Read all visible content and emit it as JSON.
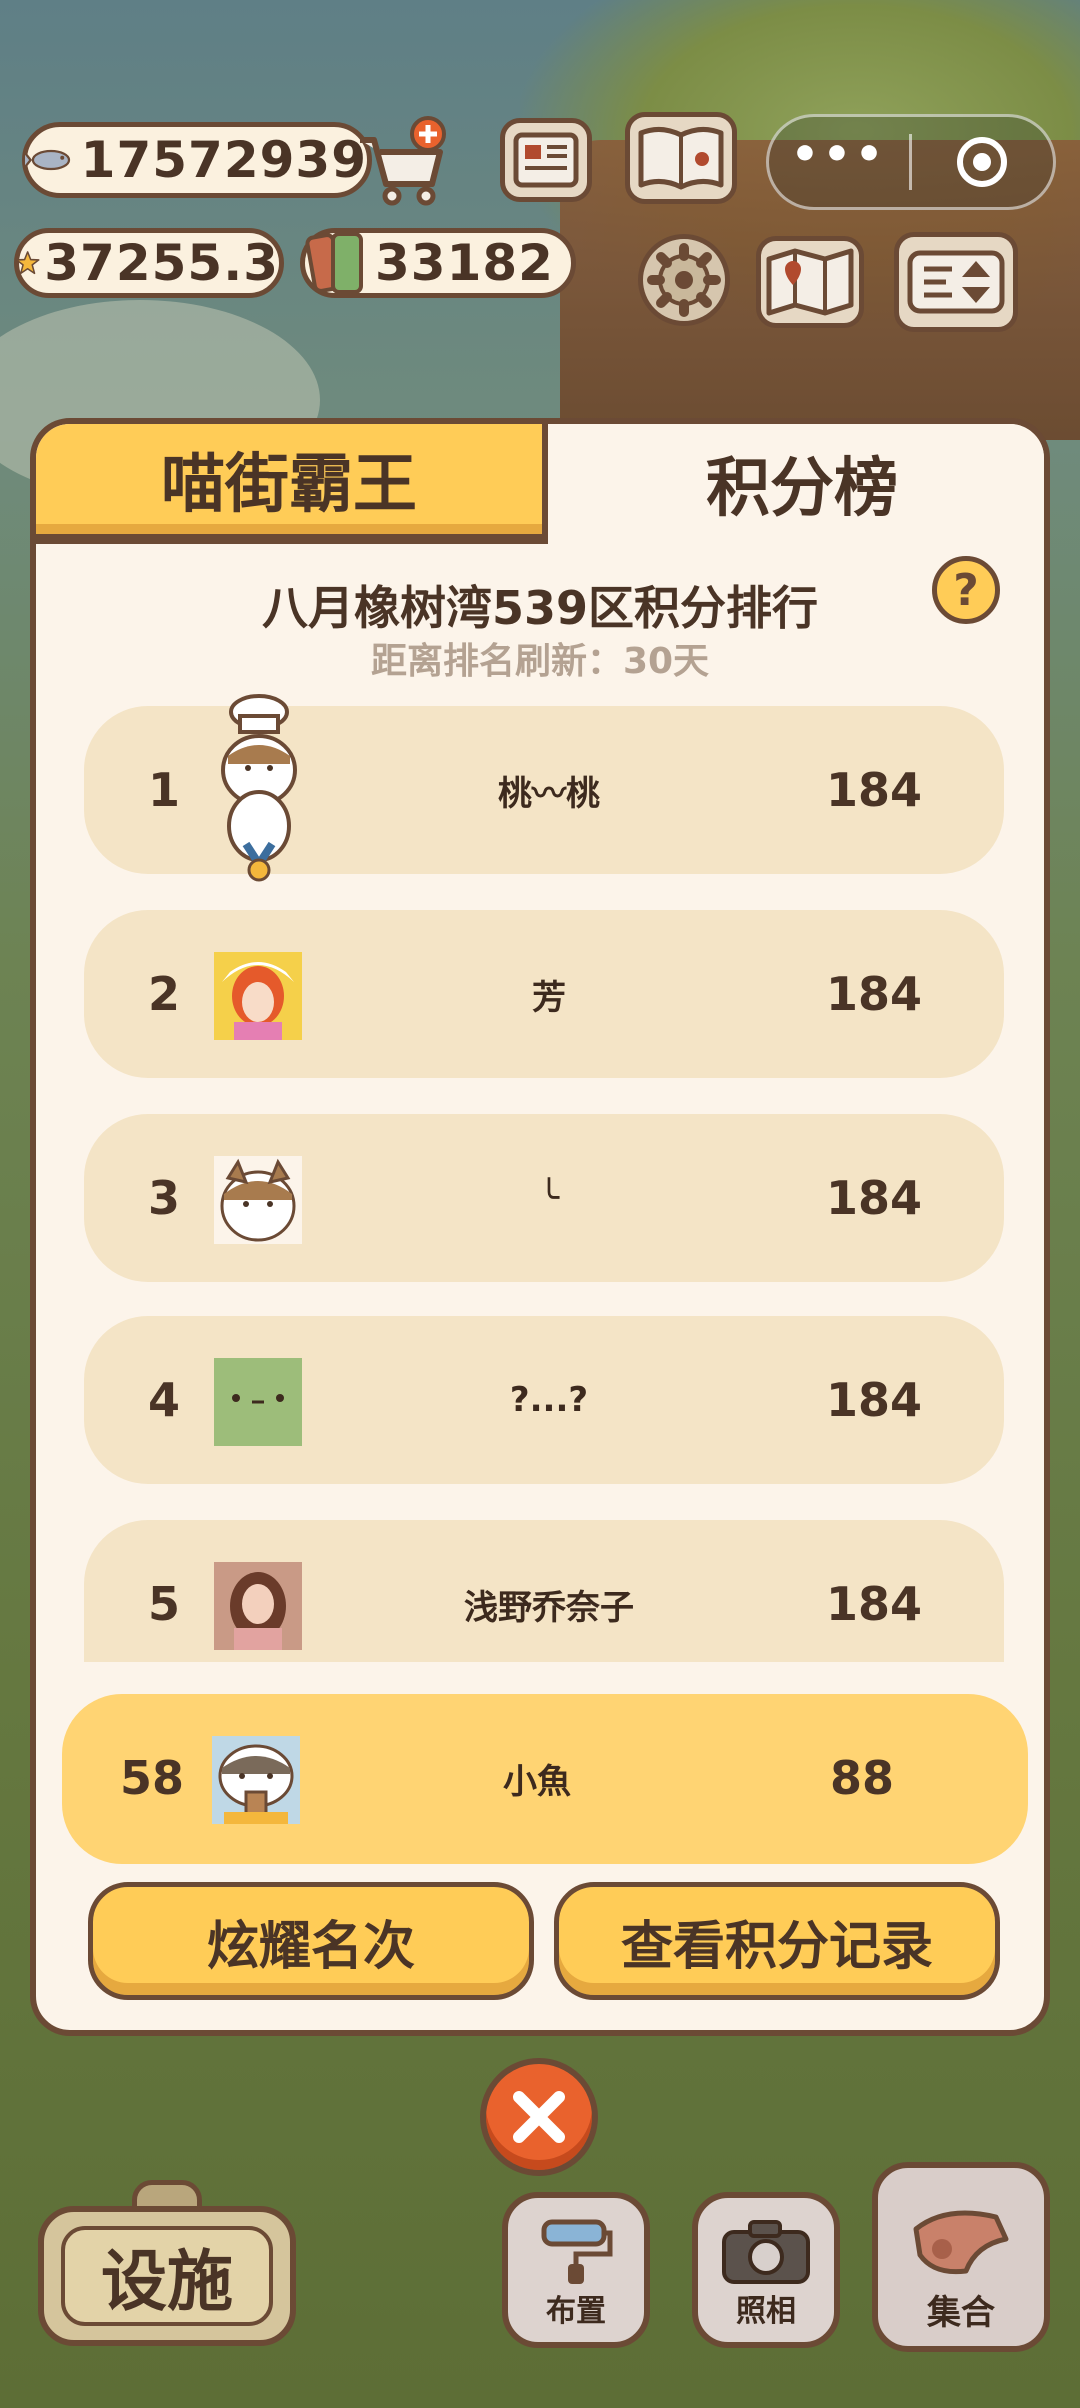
{
  "hud": {
    "fish_coins": "17572939",
    "stars": "37255.3",
    "tickets": "33182",
    "icons": [
      "fish-icon",
      "star-icon",
      "ticket-icon",
      "cart-add-icon",
      "newspaper-icon",
      "paw-book-icon",
      "gear-icon",
      "map-icon",
      "sort-icon"
    ]
  },
  "miniprogram_capsule": {
    "more": "•••"
  },
  "leaderboard": {
    "tabs": [
      "喵街霸王",
      "积分榜"
    ],
    "active_tab": "积分榜",
    "title": "八月橡树湾539区积分排行",
    "subtitle": "距离排名刷新：30天",
    "help": "?",
    "rows": [
      {
        "rank": "1",
        "name": "桃〰桃",
        "score": "184"
      },
      {
        "rank": "2",
        "name": "芳",
        "score": "184"
      },
      {
        "rank": "3",
        "name": "╰",
        "score": "184"
      },
      {
        "rank": "4",
        "name": "?...?",
        "score": "184"
      },
      {
        "rank": "5",
        "name": "浅野乔奈子",
        "score": "184"
      }
    ],
    "my_row": {
      "rank": "58",
      "name": "小魚",
      "score": "88"
    },
    "buttons": {
      "show_off": "炫耀名次",
      "score_record": "查看积分记录"
    }
  },
  "bottom": {
    "facility": "设施",
    "layout": "布置",
    "photo": "照相",
    "gather": "集合"
  },
  "colors": {
    "accent_yellow": "#ffcc57",
    "panel_bg": "#fcf4ea",
    "border_brown": "#6b4a35",
    "close_orange": "#e9622d"
  }
}
